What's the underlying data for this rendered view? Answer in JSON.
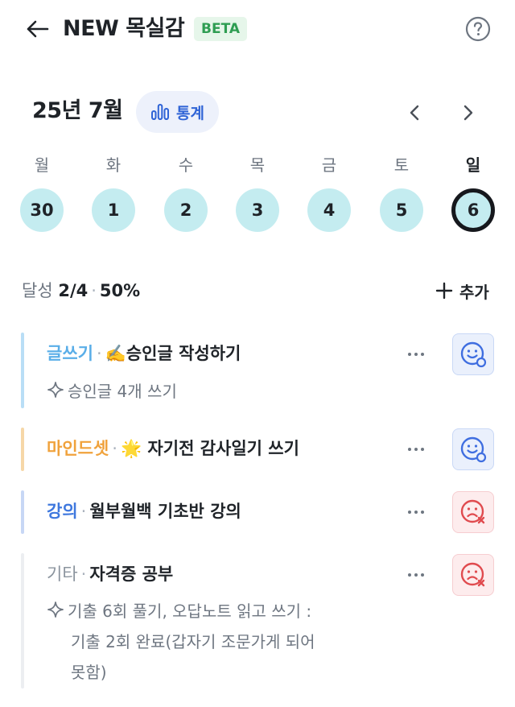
{
  "header": {
    "title": "NEW 목실감",
    "badge": "BETA"
  },
  "calendar": {
    "month_label": "25년 7월",
    "stats_label": "통계",
    "days": [
      {
        "name": "월",
        "num": "30"
      },
      {
        "name": "화",
        "num": "1"
      },
      {
        "name": "수",
        "num": "2"
      },
      {
        "name": "목",
        "num": "3"
      },
      {
        "name": "금",
        "num": "4"
      },
      {
        "name": "토",
        "num": "5"
      },
      {
        "name": "일",
        "num": "6"
      }
    ],
    "selected_day": "6"
  },
  "progress": {
    "label": "달성",
    "value": "2/4",
    "percent": "50%",
    "add_label": "추가"
  },
  "goals": [
    {
      "category": "글쓰기",
      "title": "✍️승인글 작성하기",
      "sub": "승인글 4개 쓰기",
      "color": "#5aaee8",
      "mood": "smile"
    },
    {
      "category": "마인드셋",
      "title": "🌟 자기전 감사일기 쓰기",
      "color": "#f0a23c",
      "mood": "smile"
    },
    {
      "category": "강의",
      "title": "월부월백 기초반 강의",
      "color": "#3f78de",
      "mood": "sad"
    },
    {
      "category": "기타",
      "title": "자격증 공부",
      "sub_lines": [
        "기출 6회 풀기, 오답노트 읽고 쓰기 :",
        "기출 2회 완료(갑자기 조문가게 되어",
        "못함)"
      ],
      "color": "#8b949e",
      "mood": "sad"
    }
  ],
  "colors": {
    "accent": "#2f64d6",
    "day_bg": "#c4ecf0",
    "beta_green": "#2e9d52"
  }
}
